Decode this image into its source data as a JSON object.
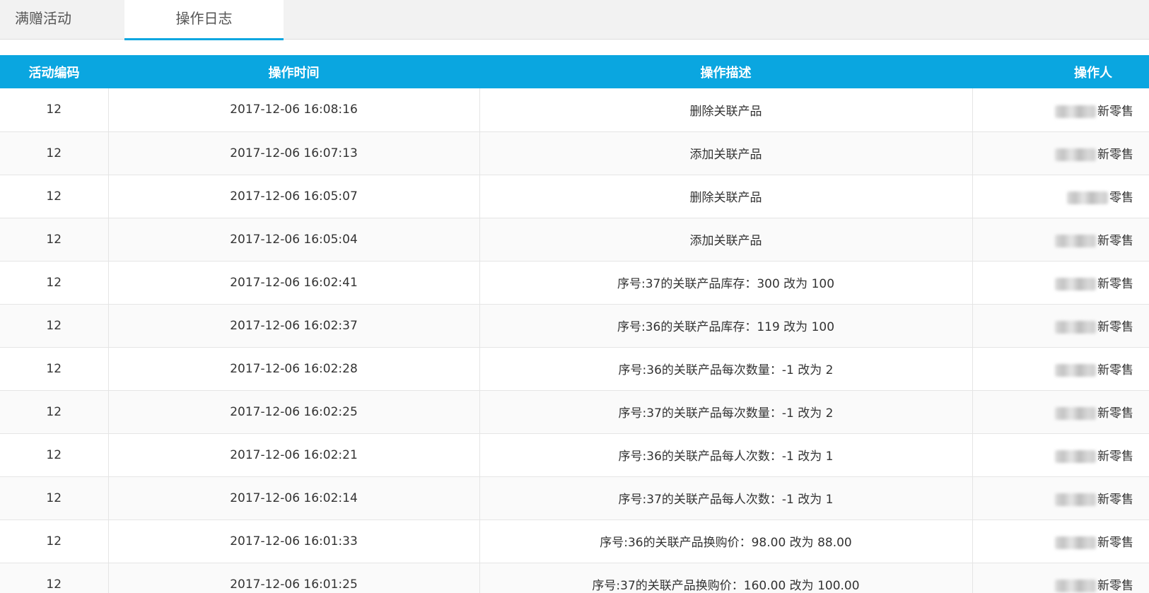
{
  "tabs": [
    {
      "label": "满赠活动",
      "active": false
    },
    {
      "label": "操作日志",
      "active": true
    }
  ],
  "colors": {
    "accent": "#0aa6e0",
    "tab_bar_bg": "#f2f2f2",
    "header_text": "#ffffff"
  },
  "table": {
    "headers": {
      "activity_code": "活动编码",
      "op_time": "操作时间",
      "op_desc": "操作描述",
      "op_person": "操作人"
    },
    "rows": [
      {
        "code": "12",
        "time": "2017-12-06 16:08:16",
        "desc": "删除关联产品",
        "person": "新零售"
      },
      {
        "code": "12",
        "time": "2017-12-06 16:07:13",
        "desc": "添加关联产品",
        "person": "新零售"
      },
      {
        "code": "12",
        "time": "2017-12-06 16:05:07",
        "desc": "删除关联产品",
        "person": "零售"
      },
      {
        "code": "12",
        "time": "2017-12-06 16:05:04",
        "desc": "添加关联产品",
        "person": "新零售"
      },
      {
        "code": "12",
        "time": "2017-12-06 16:02:41",
        "desc": "序号:37的关联产品库存：300 改为 100",
        "person": "新零售"
      },
      {
        "code": "12",
        "time": "2017-12-06 16:02:37",
        "desc": "序号:36的关联产品库存：119 改为 100",
        "person": "新零售"
      },
      {
        "code": "12",
        "time": "2017-12-06 16:02:28",
        "desc": "序号:36的关联产品每次数量：-1 改为 2",
        "person": "新零售"
      },
      {
        "code": "12",
        "time": "2017-12-06 16:02:25",
        "desc": "序号:37的关联产品每次数量：-1 改为 2",
        "person": "新零售"
      },
      {
        "code": "12",
        "time": "2017-12-06 16:02:21",
        "desc": "序号:36的关联产品每人次数：-1 改为 1",
        "person": "新零售"
      },
      {
        "code": "12",
        "time": "2017-12-06 16:02:14",
        "desc": "序号:37的关联产品每人次数：-1 改为 1",
        "person": "新零售"
      },
      {
        "code": "12",
        "time": "2017-12-06 16:01:33",
        "desc": "序号:36的关联产品换购价：98.00 改为 88.00",
        "person": "新零售"
      },
      {
        "code": "12",
        "time": "2017-12-06 16:01:25",
        "desc": "序号:37的关联产品换购价：160.00 改为 100.00",
        "person": "新零售"
      }
    ]
  }
}
